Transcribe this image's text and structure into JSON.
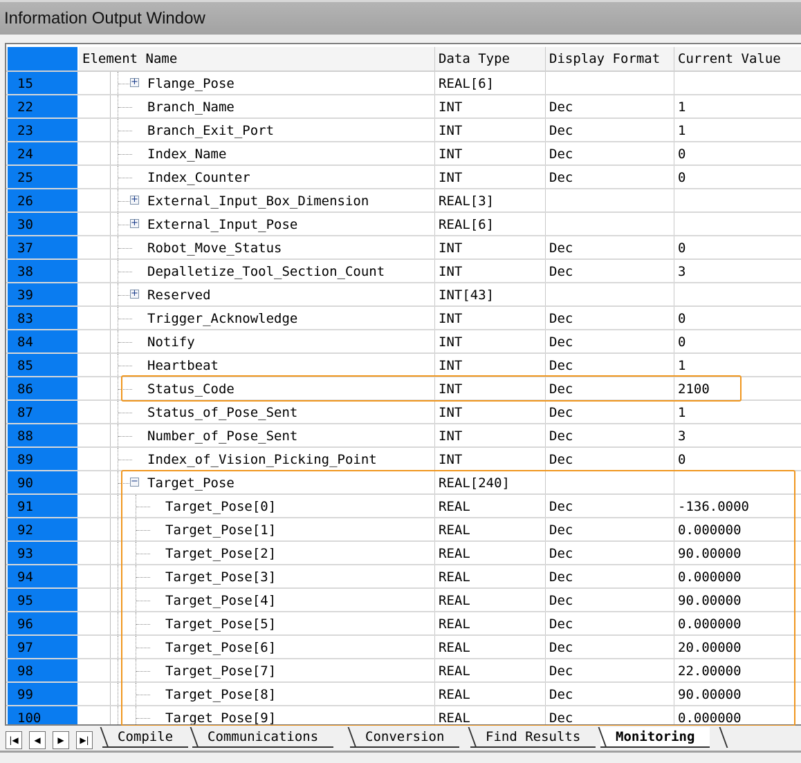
{
  "window": {
    "title": "Information Output Window"
  },
  "columns": {
    "element_name": "Element Name",
    "data_type": "Data Type",
    "display_format": "Display Format",
    "current_value": "Current Value"
  },
  "rows": [
    {
      "num": "15",
      "name": "Flange_Pose",
      "level": 1,
      "expander": "plus",
      "type": "REAL[6]",
      "format": "",
      "value": ""
    },
    {
      "num": "22",
      "name": "Branch_Name",
      "level": 1,
      "expander": "",
      "type": "INT",
      "format": "Dec",
      "value": "1"
    },
    {
      "num": "23",
      "name": "Branch_Exit_Port",
      "level": 1,
      "expander": "",
      "type": "INT",
      "format": "Dec",
      "value": "1"
    },
    {
      "num": "24",
      "name": "Index_Name",
      "level": 1,
      "expander": "",
      "type": "INT",
      "format": "Dec",
      "value": "0"
    },
    {
      "num": "25",
      "name": "Index_Counter",
      "level": 1,
      "expander": "",
      "type": "INT",
      "format": "Dec",
      "value": "0"
    },
    {
      "num": "26",
      "name": "External_Input_Box_Dimension",
      "level": 1,
      "expander": "plus",
      "type": "REAL[3]",
      "format": "",
      "value": ""
    },
    {
      "num": "30",
      "name": "External_Input_Pose",
      "level": 1,
      "expander": "plus",
      "type": "REAL[6]",
      "format": "",
      "value": ""
    },
    {
      "num": "37",
      "name": "Robot_Move_Status",
      "level": 1,
      "expander": "",
      "type": "INT",
      "format": "Dec",
      "value": "0"
    },
    {
      "num": "38",
      "name": "Depalletize_Tool_Section_Count",
      "level": 1,
      "expander": "",
      "type": "INT",
      "format": "Dec",
      "value": "3"
    },
    {
      "num": "39",
      "name": "Reserved",
      "level": 1,
      "expander": "plus",
      "type": "INT[43]",
      "format": "",
      "value": ""
    },
    {
      "num": "83",
      "name": "Trigger_Acknowledge",
      "level": 1,
      "expander": "",
      "type": "INT",
      "format": "Dec",
      "value": "0"
    },
    {
      "num": "84",
      "name": "Notify",
      "level": 1,
      "expander": "",
      "type": "INT",
      "format": "Dec",
      "value": "0"
    },
    {
      "num": "85",
      "name": "Heartbeat",
      "level": 1,
      "expander": "",
      "type": "INT",
      "format": "Dec",
      "value": "1"
    },
    {
      "num": "86",
      "name": "Status_Code",
      "level": 1,
      "expander": "",
      "type": "INT",
      "format": "Dec",
      "value": "2100"
    },
    {
      "num": "87",
      "name": "Status_of_Pose_Sent",
      "level": 1,
      "expander": "",
      "type": "INT",
      "format": "Dec",
      "value": "1"
    },
    {
      "num": "88",
      "name": "Number_of_Pose_Sent",
      "level": 1,
      "expander": "",
      "type": "INT",
      "format": "Dec",
      "value": "3"
    },
    {
      "num": "89",
      "name": "Index_of_Vision_Picking_Point",
      "level": 1,
      "expander": "",
      "type": "INT",
      "format": "Dec",
      "value": "0"
    },
    {
      "num": "90",
      "name": "Target_Pose",
      "level": 1,
      "expander": "minus",
      "type": "REAL[240]",
      "format": "",
      "value": ""
    },
    {
      "num": "91",
      "name": "Target_Pose[0]",
      "level": 2,
      "expander": "",
      "type": "REAL",
      "format": "Dec",
      "value": "-136.0000"
    },
    {
      "num": "92",
      "name": "Target_Pose[1]",
      "level": 2,
      "expander": "",
      "type": "REAL",
      "format": "Dec",
      "value": "0.000000"
    },
    {
      "num": "93",
      "name": "Target_Pose[2]",
      "level": 2,
      "expander": "",
      "type": "REAL",
      "format": "Dec",
      "value": "90.00000"
    },
    {
      "num": "94",
      "name": "Target_Pose[3]",
      "level": 2,
      "expander": "",
      "type": "REAL",
      "format": "Dec",
      "value": "0.000000"
    },
    {
      "num": "95",
      "name": "Target_Pose[4]",
      "level": 2,
      "expander": "",
      "type": "REAL",
      "format": "Dec",
      "value": "90.00000"
    },
    {
      "num": "96",
      "name": "Target_Pose[5]",
      "level": 2,
      "expander": "",
      "type": "REAL",
      "format": "Dec",
      "value": "0.000000"
    },
    {
      "num": "97",
      "name": "Target_Pose[6]",
      "level": 2,
      "expander": "",
      "type": "REAL",
      "format": "Dec",
      "value": "20.00000"
    },
    {
      "num": "98",
      "name": "Target_Pose[7]",
      "level": 2,
      "expander": "",
      "type": "REAL",
      "format": "Dec",
      "value": "22.00000"
    },
    {
      "num": "99",
      "name": "Target_Pose[8]",
      "level": 2,
      "expander": "",
      "type": "REAL",
      "format": "Dec",
      "value": "90.00000"
    },
    {
      "num": "100",
      "name": "Target_Pose[9]",
      "level": 2,
      "expander": "",
      "type": "REAL",
      "format": "Dec",
      "value": "0.000000"
    }
  ],
  "highlights": {
    "color": "#f0961e"
  },
  "tabs": [
    {
      "label": "Compile",
      "active": false
    },
    {
      "label": "Communications",
      "active": false
    },
    {
      "label": "Conversion",
      "active": false
    },
    {
      "label": "Find Results",
      "active": false
    },
    {
      "label": "Monitoring",
      "active": true
    }
  ],
  "nav_icons": [
    "first-icon",
    "prev-icon",
    "next-icon",
    "last-icon"
  ],
  "colors": {
    "row_number_bg": "#0a7cf0"
  }
}
